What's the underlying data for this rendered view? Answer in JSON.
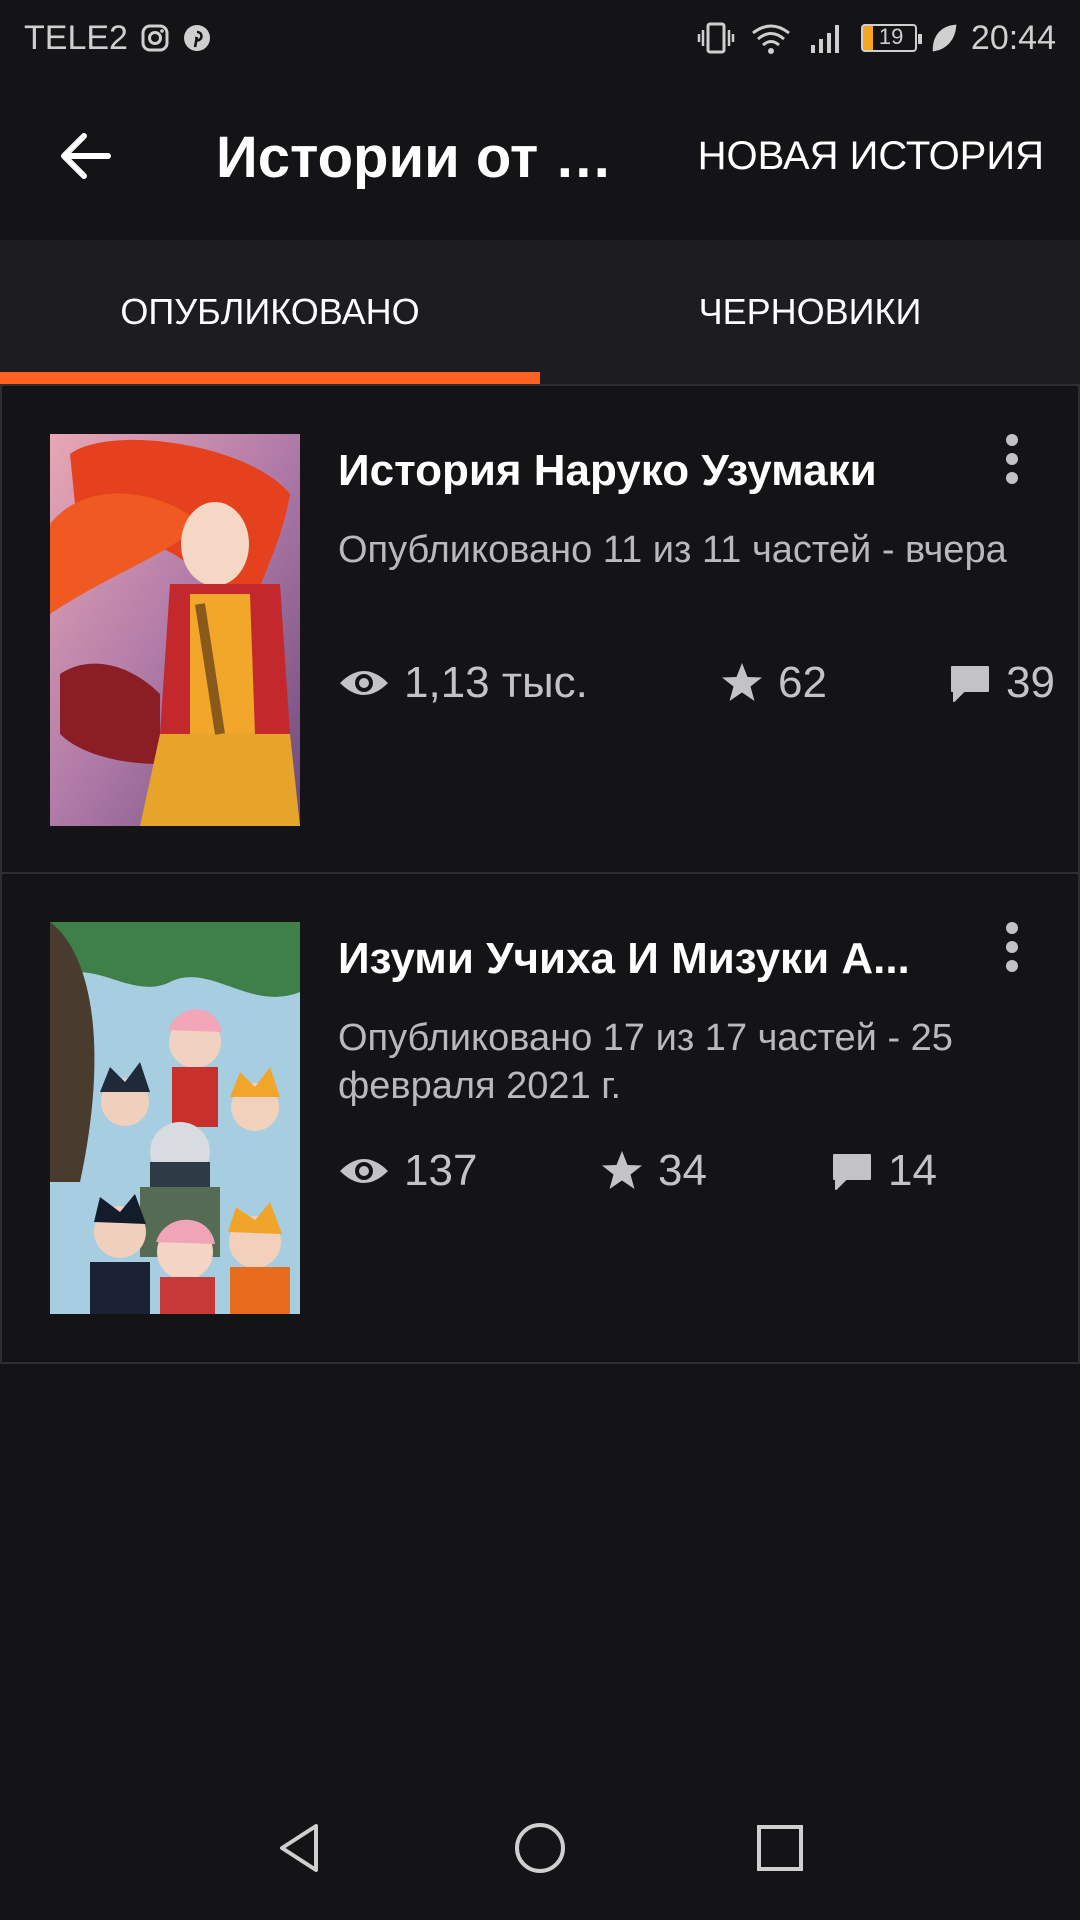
{
  "status_bar": {
    "carrier": "TELE2",
    "battery_level": "19",
    "time": "20:44"
  },
  "app_bar": {
    "title": "Истории от t...",
    "new_story_label": "НОВАЯ ИСТОРИЯ"
  },
  "tabs": [
    {
      "label": "ОПУБЛИКОВАНО",
      "active": true
    },
    {
      "label": "ЧЕРНОВИКИ",
      "active": false
    }
  ],
  "stories": [
    {
      "title": "История Наруко Узумаки",
      "meta": "Опубликовано 11 из 11 частей - вчера",
      "views": "1,13 тыс.",
      "votes": "62",
      "comments": "39"
    },
    {
      "title": "Изуми Учиха И Мизуки А...",
      "meta": "Опубликовано 17 из 17 частей - 25 февраля 2021 г.",
      "views": "137",
      "votes": "34",
      "comments": "14"
    }
  ],
  "colors": {
    "accent": "#ff6122",
    "background": "#141316",
    "tab_bar": "#1d1c20"
  }
}
